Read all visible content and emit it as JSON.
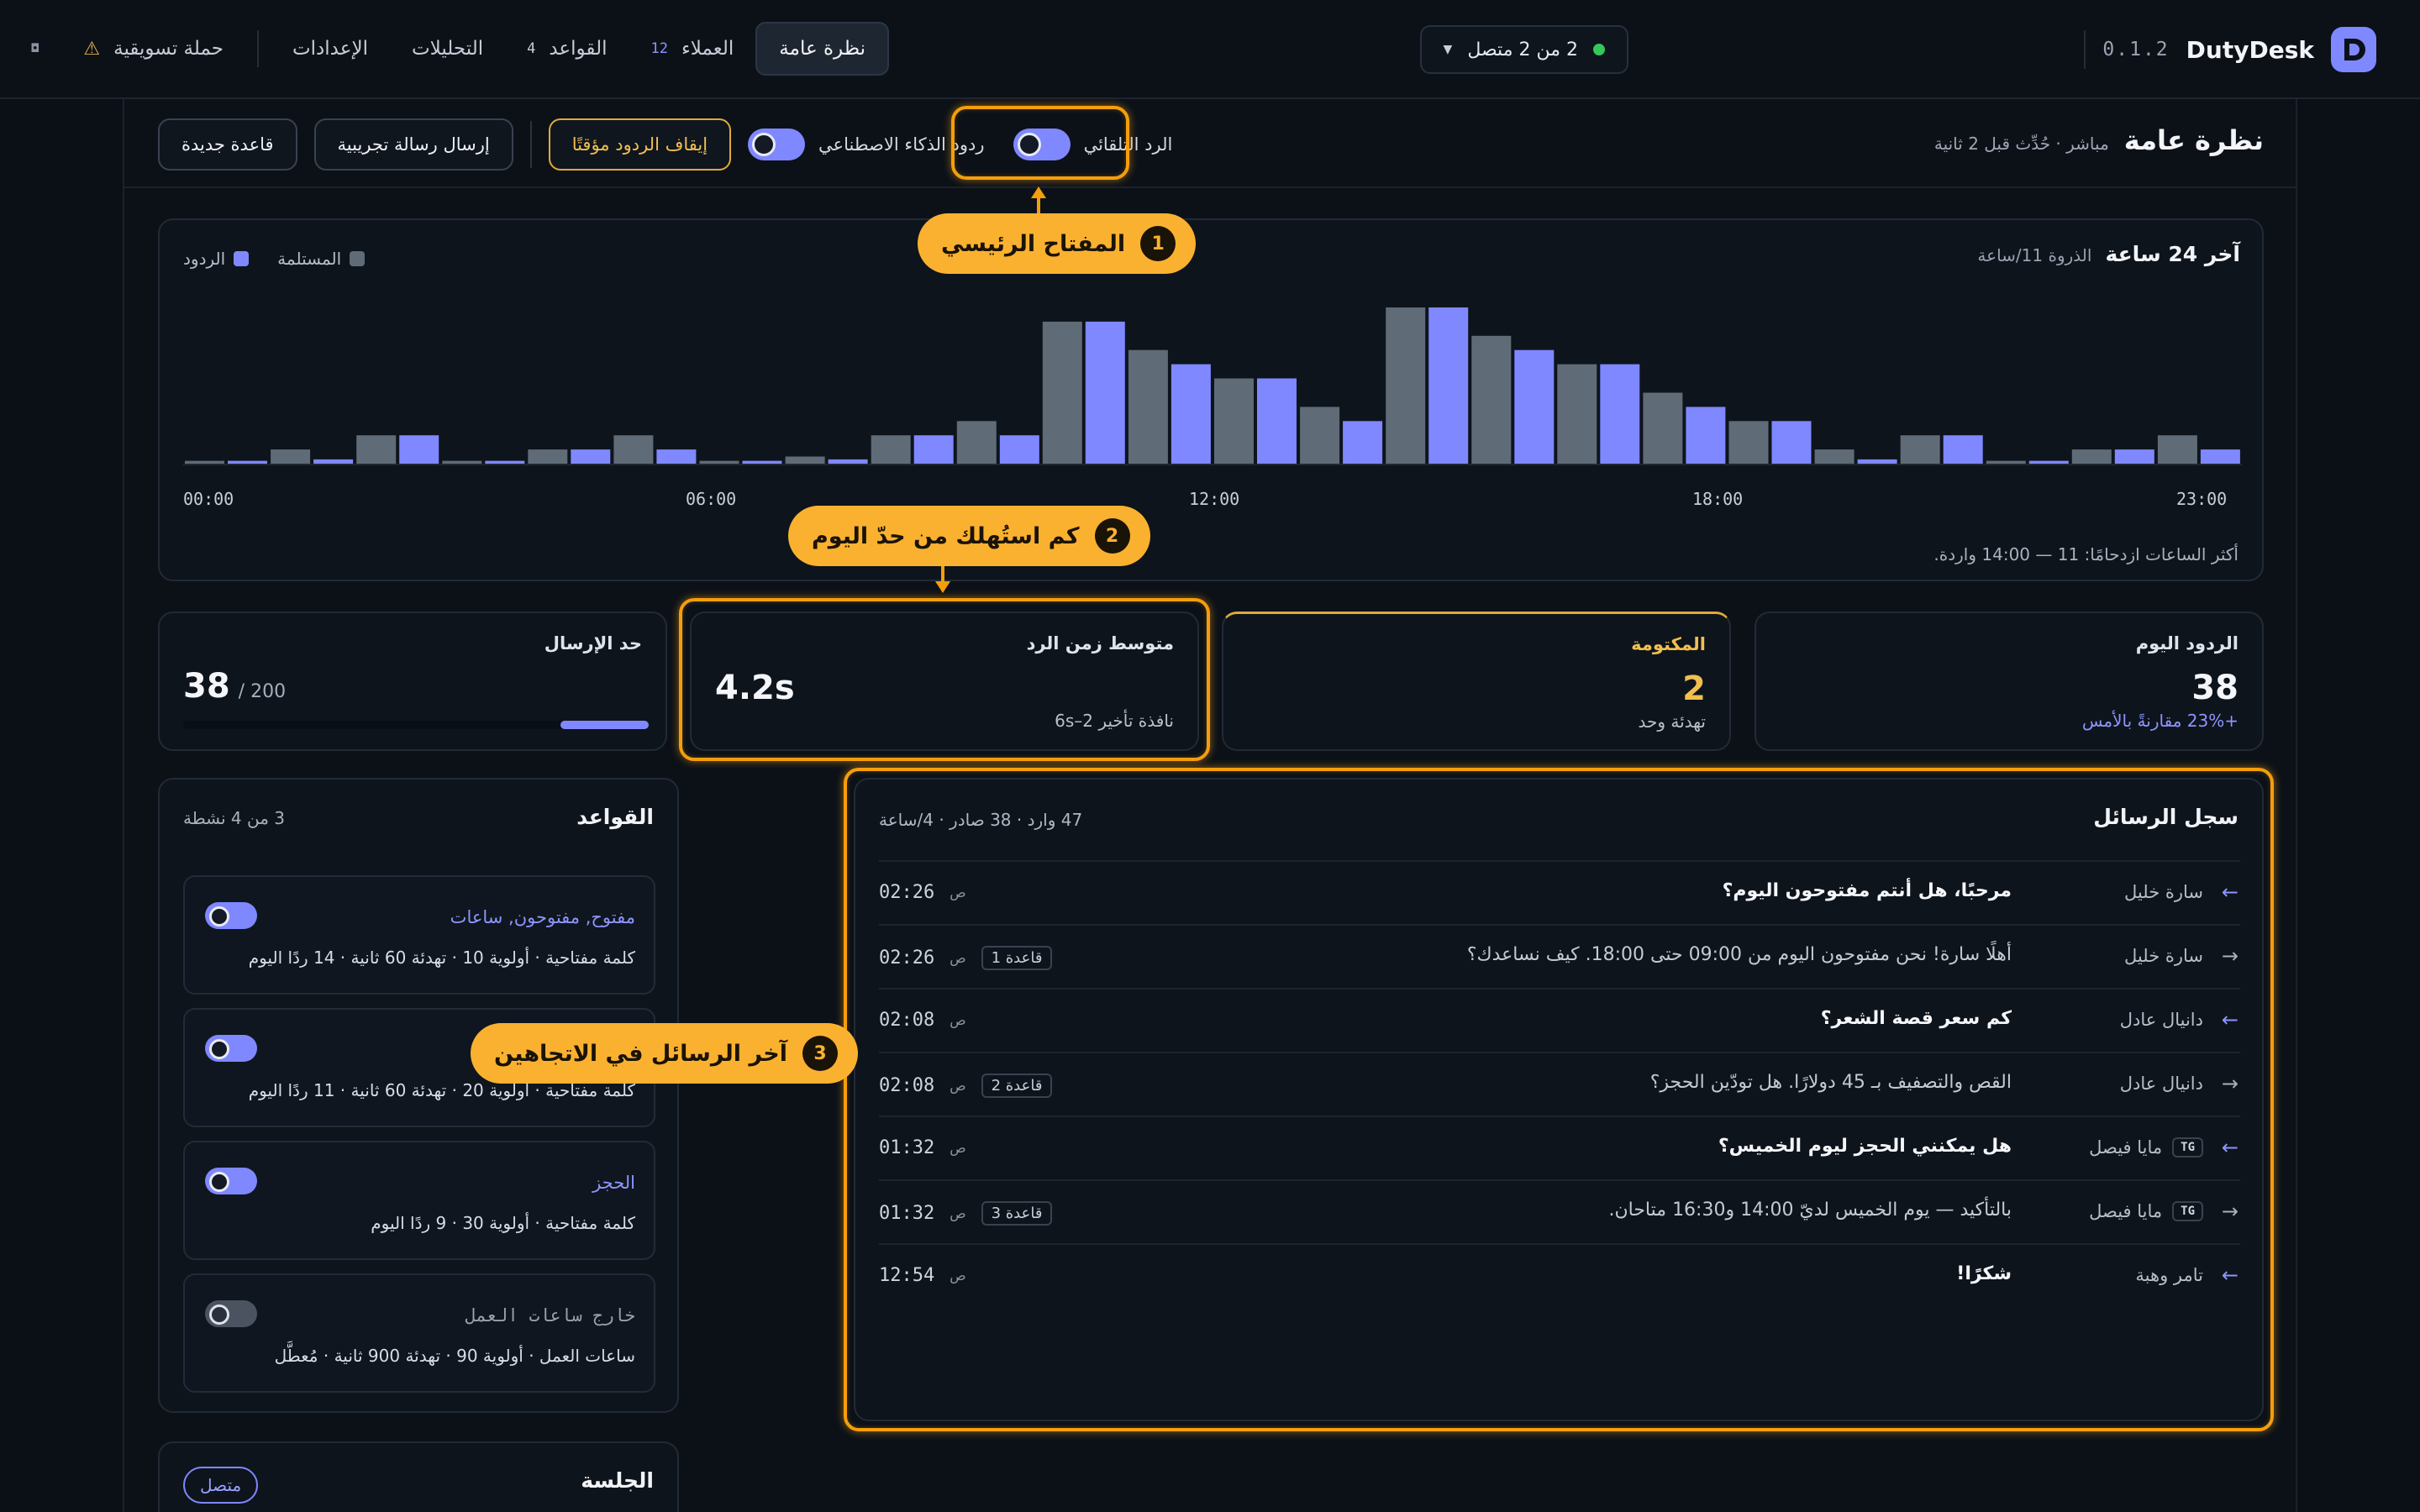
{
  "app": {
    "name": "DutyDesk",
    "version": "0.1.2",
    "connection": "2 من 2 متصل"
  },
  "nav": {
    "overview": "نظرة عامة",
    "customers": "العملاء",
    "customers_count": "12",
    "rules": "القواعد",
    "rules_count": "4",
    "analytics": "التحليلات",
    "settings": "الإعدادات",
    "campaign": "حملة تسويقية",
    "extra": "◘"
  },
  "header": {
    "title": "نظرة عامة",
    "subtitle": "مباشر · حُدِّث قبل 2 ثانية",
    "auto_reply": "الرد التلقائي",
    "ai_replies": "ردود الذكاء الاصطناعي",
    "pause": "إيقاف الردود مؤقتًا",
    "test_message": "إرسال رسالة تجريبية",
    "new_rule": "قاعدة جديدة"
  },
  "chart": {
    "title": "آخر 24 ساعة",
    "subtitle": "الذروة 11/ساعة",
    "peak_note": "أكثر الساعات ازدحامًا: 11 — 14:00 واردة.",
    "x_ticks": [
      "00:00",
      "06:00",
      "12:00",
      "18:00",
      "23:00"
    ]
  },
  "chart_data": {
    "type": "bar",
    "categories": [
      "00",
      "01",
      "02",
      "03",
      "04",
      "05",
      "06",
      "07",
      "08",
      "09",
      "10",
      "11",
      "12",
      "13",
      "14",
      "15",
      "16",
      "17",
      "18",
      "19",
      "20",
      "21",
      "22",
      "23"
    ],
    "series": [
      {
        "name": "المستلمة",
        "color": "#5f6b77",
        "values": [
          0.2,
          1,
          2,
          0.2,
          1,
          2,
          0.2,
          0.5,
          2,
          3,
          10,
          8,
          6,
          4,
          11,
          9,
          7,
          5,
          3,
          1,
          2,
          0.2,
          1,
          2
        ]
      },
      {
        "name": "الردود",
        "color": "#7f88ff",
        "values": [
          0.2,
          0.3,
          2,
          0.2,
          1,
          1,
          0.2,
          0.3,
          2,
          2,
          10,
          7,
          6,
          3,
          11,
          8,
          7,
          4,
          3,
          0.3,
          2,
          0.2,
          1,
          1
        ]
      }
    ],
    "legend": [
      "المستلمة",
      "الردود"
    ],
    "legend_position": "top-left",
    "x_ticks": [
      "00:00",
      "06:00",
      "12:00",
      "18:00",
      "23:00"
    ]
  },
  "stats": {
    "today": {
      "label": "الردود اليوم",
      "value": "38",
      "foot": "+23% مقارنةً بالأمس"
    },
    "muted": {
      "label": "المكتومة",
      "value": "2",
      "foot": "تهدئة وحد"
    },
    "avg": {
      "label": "متوسط زمن الرد",
      "value": "4.2s",
      "foot": "نافذة تأخير 2–6s"
    },
    "limit": {
      "label": "حد الإرسال",
      "value": "38",
      "max": "/ 200",
      "used_fraction": 0.19
    }
  },
  "rules": {
    "title": "القواعد",
    "subtitle": "3 من 4 نشطة",
    "items": [
      {
        "name": "مفتوح, مفتوحون, ساعات",
        "meta": "كلمة مفتاحية · أولوية 10 · تهدئة 60 ثانية · 14 ردًا اليوم",
        "enabled": true
      },
      {
        "name": "",
        "meta": "كلمة مفتاحية · أولوية 20 · تهدئة 60 ثانية · 11 ردًا اليوم",
        "enabled": true
      },
      {
        "name": "الحجز",
        "meta": "كلمة مفتاحية · أولوية 30 · 9 ردًا اليوم",
        "enabled": true
      },
      {
        "name": "خارج ساعات العمل",
        "meta": "ساعات العمل · أولوية 90 · تهدئة 900 ثانية · مُعطَّل",
        "enabled": false
      }
    ]
  },
  "session": {
    "title": "الجلسة",
    "status": "متصل"
  },
  "messages": {
    "title": "سجل الرسائل",
    "subtitle": "47 وارد · 38 صادر · 4/ساعة",
    "am": "ص",
    "rows": [
      {
        "dir": "in",
        "sender": "سارة خليل",
        "tg": false,
        "text": "مرحبًا، هل أنتم مفتوحون اليوم؟",
        "rule": "",
        "time": "02:26"
      },
      {
        "dir": "out",
        "sender": "سارة خليل",
        "tg": false,
        "text": "أهلًا سارة! نحن مفتوحون اليوم من 09:00 حتى 18:00. كيف نساعدك؟",
        "rule": "قاعدة 1",
        "time": "02:26"
      },
      {
        "dir": "in",
        "sender": "دانيال عادل",
        "tg": false,
        "text": "كم سعر قصة الشعر؟",
        "rule": "",
        "time": "02:08"
      },
      {
        "dir": "out",
        "sender": "دانيال عادل",
        "tg": false,
        "text": "القص والتصفيف بـ 45 دولارًا. هل تودّين الحجز؟",
        "rule": "قاعدة 2",
        "time": "02:08"
      },
      {
        "dir": "in",
        "sender": "مايا فيصل",
        "tg": true,
        "text": "هل يمكنني الحجز ليوم الخميس؟",
        "rule": "",
        "time": "01:32"
      },
      {
        "dir": "out",
        "sender": "مايا فيصل",
        "tg": true,
        "text": "بالتأكيد — يوم الخميس لديّ 14:00 و16:30 متاحان.",
        "rule": "قاعدة 3",
        "time": "01:32"
      },
      {
        "dir": "in",
        "sender": "تامر وهبة",
        "tg": false,
        "text": "شكرًا!",
        "rule": "",
        "time": "12:54"
      }
    ],
    "tg_label": "TG"
  },
  "callouts": {
    "c1": {
      "n": "1",
      "text": "المفتاح الرئيسي"
    },
    "c2": {
      "n": "2",
      "text": "كم استُهلك من حدّ اليوم"
    },
    "c3": {
      "n": "3",
      "text": "آخر الرسائل في الاتجاهين"
    }
  }
}
